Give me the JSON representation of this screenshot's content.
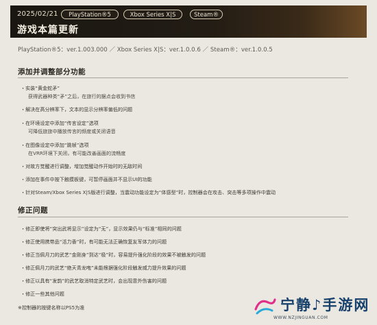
{
  "header": {
    "date": "2025/02/21",
    "platforms": [
      "PlayStation®5",
      "Xbox Series X|S",
      "Steam®"
    ],
    "title": "游戏本篇更新"
  },
  "version_line": "PlayStation®5：ver.1.003.000 ／ Xbox Series X|S：ver.1.0.0.6 ／ Steam®：ver.1.0.0.5",
  "sections": [
    {
      "heading": "添加并调整部分功能",
      "items": [
        {
          "text": "・实装“黄金蛇矛”",
          "sub": [
            "获得武器种类“矛”之后，在旅行的据点会收到书信"
          ]
        },
        {
          "text": "・解决在高分辨率下，文本的显示分辨率偏低的问题",
          "sub": []
        },
        {
          "text": "・在环境设定中添加“传言设定”选项",
          "sub": [
            "可降低旅旅中播放传言的频度或关闭语音"
          ]
        },
        {
          "text": "・在图像设定中添加“跳帧”选项",
          "sub": [
            "在VRR环境下关闭，有可能改善画面的流畅度"
          ]
        },
        {
          "text": "・对故方觉醒进行调整，增加觉醒动作开始时的无敌时间",
          "sub": []
        },
        {
          "text": "・添加在事件中按下触摸板键，可暂停画面并不显示UI的功能",
          "sub": []
        },
        {
          "text": "・针对Steam/Xbox Series X|S版进行调整，当震动功能设定为“体感型”时，控制器会在攻击、突击等多项操作中震动",
          "sub": []
        }
      ]
    },
    {
      "heading": "修正问题",
      "items": [
        {
          "text": "・修正即使将“突出武将显示”设定为“无”，显示效果仍与“标准”相同的问题",
          "sub": []
        },
        {
          "text": "・修正使用携带品“活力香”时，有可能无法正确恢复友军体力的问题",
          "sub": []
        },
        {
          "text": "・修正当佩月刀的武艺“金刚身”到达“极”时，容易提升强化阶段的效果不被触发的问题",
          "sub": []
        },
        {
          "text": "・修正佩月刀的武艺“绝天青龙咆”未能根据强化阶段触发威力提升效果的问题",
          "sub": []
        },
        {
          "text": "・修正以具有“发韵”的武艺取消特定武艺时，会出现意外伤害的问题",
          "sub": []
        },
        {
          "text": "・修正一些其他问题",
          "sub": []
        }
      ]
    }
  ],
  "footnote": "※控制器的按键名称以PS5为准",
  "watermark": {
    "text": "宁静♪手游网",
    "url": "WWW.NZJINGUAN.COM"
  }
}
